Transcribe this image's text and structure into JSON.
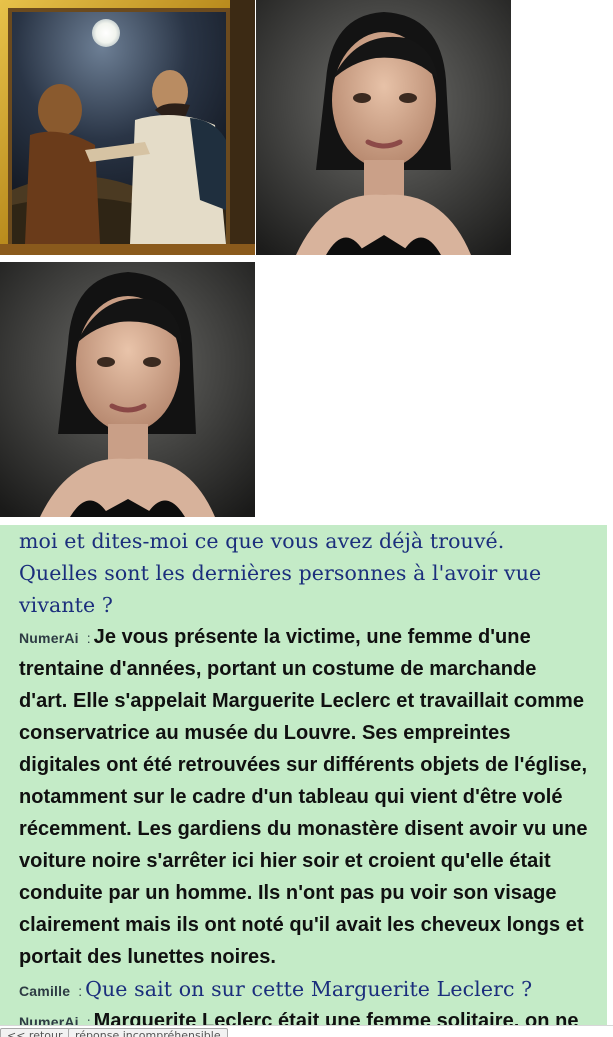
{
  "images": [
    {
      "name": "painting-image",
      "subject": "painting in gilded frame with bearded man"
    },
    {
      "name": "portrait-image-1",
      "subject": "portrait of dark-haired woman"
    },
    {
      "name": "portrait-image-2",
      "subject": "portrait of dark-haired woman"
    }
  ],
  "chat": {
    "user_msg_1": "moi et dites-moi ce que vous avez déjà trouvé. Quelles sont les dernières personnes à l'avoir vue vivante ?",
    "ai_speaker_1": "NumerAi",
    "sep_1": ":",
    "ai_msg_1": "Je vous présente la victime, une femme d'une trentaine d'années, portant un costume de marchande d'art. Elle s'appelait Marguerite Leclerc et travaillait comme conservatrice au musée du Louvre. Ses empreintes digitales ont été retrouvées sur différents objets de l'église, notamment sur le cadre d'un tableau qui vient d'être volé récemment. Les gardiens du monastère disent avoir vu une voiture noire s'arrêter ici hier soir et croient qu'elle était conduite par un homme. Ils n'ont pas pu voir son visage clairement mais ils ont noté qu'il avait les cheveux longs et portait des lunettes noires.",
    "user_speaker_2": "Camille",
    "sep_2": ":",
    "user_msg_2": "Que sait on sur cette Marguerite Leclerc ?",
    "ai_speaker_2": "NumerAi",
    "sep_3": ":",
    "ai_msg_2": "Marguerite Leclerc était une femme solitaire, on ne sait pas grand-chose d'elle hormis qu'elle vivait seule dans"
  },
  "bottom_bar": {
    "return_label": "<< retour",
    "incomprehensible_label": "réponse incompréhensible"
  },
  "colors": {
    "chat_bg": "#c4ebc7",
    "user_text": "#1b2e7c",
    "ai_text": "#101010"
  }
}
